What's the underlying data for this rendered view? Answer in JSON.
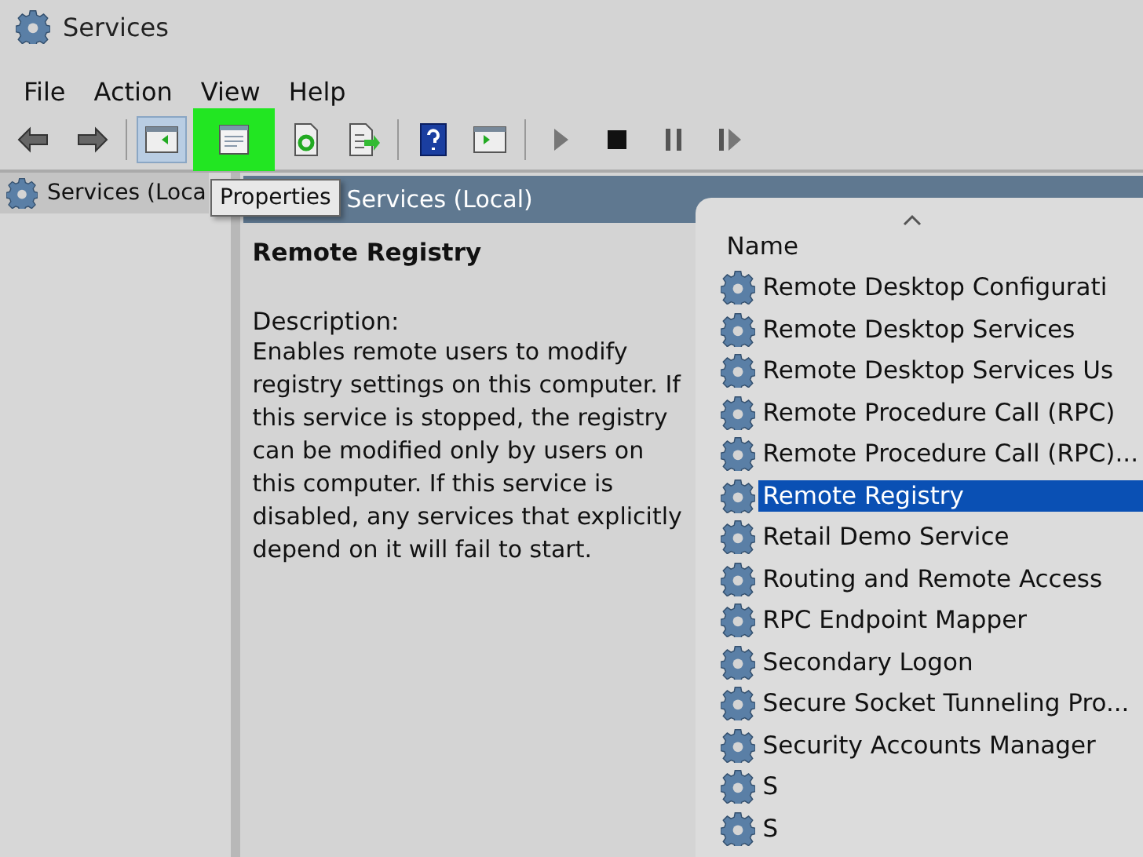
{
  "window": {
    "title": "Services"
  },
  "menu": [
    "File",
    "Action",
    "View",
    "Help"
  ],
  "toolbar": [
    {
      "kind": "back",
      "pressed": false,
      "highlighted": false
    },
    {
      "kind": "forward",
      "pressed": false,
      "highlighted": false
    },
    {
      "kind": "separator"
    },
    {
      "kind": "console-tree",
      "pressed": true,
      "highlighted": false
    },
    {
      "kind": "properties",
      "pressed": false,
      "highlighted": true
    },
    {
      "kind": "refresh",
      "pressed": false,
      "highlighted": false
    },
    {
      "kind": "export",
      "pressed": false,
      "highlighted": false
    },
    {
      "kind": "separator"
    },
    {
      "kind": "help",
      "pressed": false,
      "highlighted": false
    },
    {
      "kind": "action-pane",
      "pressed": false,
      "highlighted": false
    },
    {
      "kind": "separator"
    },
    {
      "kind": "start",
      "pressed": false,
      "highlighted": false
    },
    {
      "kind": "stop",
      "pressed": false,
      "highlighted": false
    },
    {
      "kind": "pause",
      "pressed": false,
      "highlighted": false
    },
    {
      "kind": "resume",
      "pressed": false,
      "highlighted": false
    }
  ],
  "tooltip": "Properties",
  "tree": {
    "items": [
      {
        "label": "Services (Loca",
        "selected": true
      }
    ]
  },
  "header": "Services (Local)",
  "detail": {
    "title": "Remote Registry",
    "description_label": "Description:",
    "description": "Enables remote users to modify registry settings on this computer. If this service is stopped, the registry can be modified only by users on this computer. If this service is disabled, any services that explicitly depend on it will fail to start."
  },
  "list": {
    "column": "Name",
    "rows": [
      {
        "name": "Remote Desktop Configurati",
        "selected": false
      },
      {
        "name": "Remote Desktop Services",
        "selected": false
      },
      {
        "name": "Remote Desktop Services Us",
        "selected": false
      },
      {
        "name": "Remote Procedure Call (RPC)",
        "selected": false
      },
      {
        "name": "Remote Procedure Call (RPC)...",
        "selected": false
      },
      {
        "name": "Remote Registry",
        "selected": true
      },
      {
        "name": "Retail Demo Service",
        "selected": false
      },
      {
        "name": "Routing and Remote Access",
        "selected": false
      },
      {
        "name": "RPC Endpoint Mapper",
        "selected": false
      },
      {
        "name": "Secondary Logon",
        "selected": false
      },
      {
        "name": "Secure Socket Tunneling Pro...",
        "selected": false
      },
      {
        "name": "Security Accounts Manager",
        "selected": false
      },
      {
        "name": "S",
        "selected": false
      },
      {
        "name": "S",
        "selected": false
      }
    ]
  }
}
